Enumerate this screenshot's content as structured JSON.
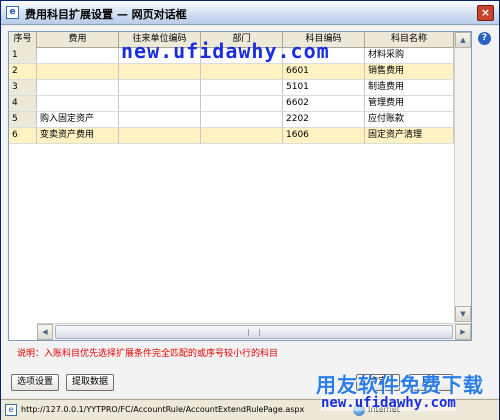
{
  "window": {
    "title": "费用科目扩展设置  —  网页对话框",
    "close_label": "×"
  },
  "grid": {
    "columns": [
      "序号",
      "费用",
      "往来单位编码",
      "部门",
      "科目编码",
      "科目名称"
    ],
    "rows": [
      {
        "no": "1",
        "fee": "",
        "unit_code": "",
        "dept": "",
        "subject_code": "",
        "subject_name": "材料采购"
      },
      {
        "no": "2",
        "fee": "",
        "unit_code": "",
        "dept": "",
        "subject_code": "6601",
        "subject_name": "销售费用"
      },
      {
        "no": "3",
        "fee": "",
        "unit_code": "",
        "dept": "",
        "subject_code": "5101",
        "subject_name": "制造费用"
      },
      {
        "no": "4",
        "fee": "",
        "unit_code": "",
        "dept": "",
        "subject_code": "6602",
        "subject_name": "管理费用"
      },
      {
        "no": "5",
        "fee": "购入固定资产",
        "unit_code": "",
        "dept": "",
        "subject_code": "2202",
        "subject_name": "应付账款"
      },
      {
        "no": "6",
        "fee": "变卖资产费用",
        "unit_code": "",
        "dept": "",
        "subject_code": "1606",
        "subject_name": "固定资产清理"
      }
    ],
    "highlight_color": "#fff3c4"
  },
  "note": "说明：入账科目优先选择扩展条件完全匹配的或序号较小行的科目",
  "buttons": {
    "options": "选项设置",
    "fetch": "提取数据",
    "confirm": "确定",
    "cancel": "取消"
  },
  "status": {
    "url": "http://127.0.0.1/YYTPRO/FC/AccountRule/AccountExtendRulePage.aspx",
    "zone": "Internet"
  },
  "watermark": {
    "top": "new.ufidawhy.com",
    "brand": "用友软件免费下载",
    "url": "new.ufidawhy.com"
  },
  "colors": {
    "title_bar": "#d8e4f4",
    "note_text": "#e00000",
    "watermark_blue": "#1a2ee0"
  }
}
